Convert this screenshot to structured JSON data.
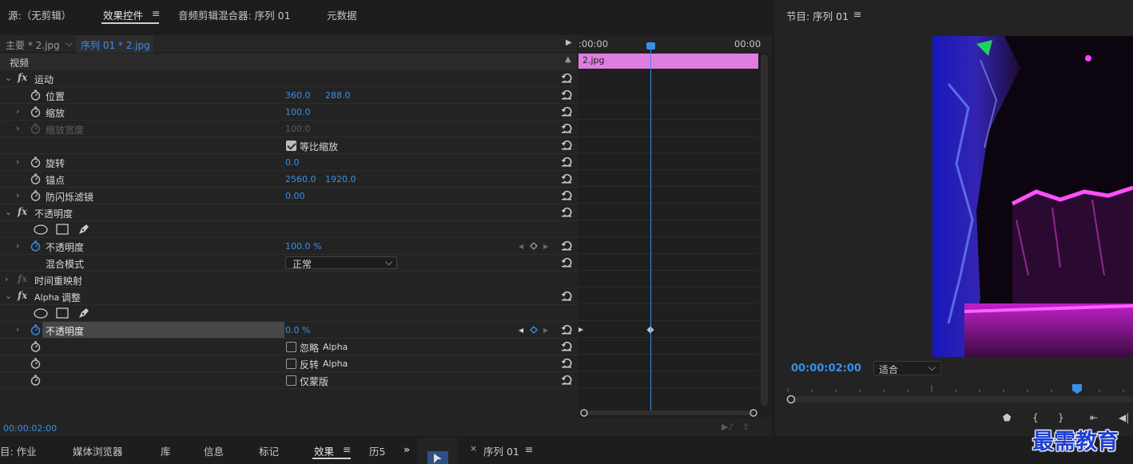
{
  "top_tabs": {
    "source": "源:（无剪辑）",
    "effect_controls": "效果控件",
    "audio_mixer": "音频剪辑混合器: 序列 01",
    "metadata": "元数据"
  },
  "ec": {
    "master_clip": "主要 * 2.jpg",
    "sequence_clip": "序列 01 * 2.jpg",
    "section_video": "视频",
    "timecode_start": ":00:00",
    "timecode_end": "00:00",
    "clip_name": "2.jpg",
    "current_time": "00:00:02:00",
    "motion": {
      "title": "运动",
      "position_label": "位置",
      "position_x": "360.0",
      "position_y": "288.0",
      "scale_label": "缩放",
      "scale_value": "100.0",
      "scale_width_label": "缩放宽度",
      "scale_width_value": "100.0",
      "uniform_scale_label": "等比缩放",
      "rotation_label": "旋转",
      "rotation_value": "0.0",
      "anchor_label": "锚点",
      "anchor_x": "2560.0",
      "anchor_y": "1920.0",
      "antiflicker_label": "防闪烁滤镜",
      "antiflicker_value": "0.00"
    },
    "opacity": {
      "title": "不透明度",
      "opacity_label": "不透明度",
      "opacity_value": "100.0 %",
      "blend_label": "混合模式",
      "blend_value": "正常"
    },
    "time_remap": {
      "title": "时间重映射"
    },
    "alpha_adjust": {
      "title_alpha": "Alpha",
      "title_rest": "调整",
      "opacity_label": "不透明度",
      "opacity_value": "0.0 %",
      "ignore_label": "忽略",
      "invert_label": "反转",
      "alpha_word": "Alpha",
      "mask_only_label": "仅蒙版"
    }
  },
  "program": {
    "title": "节目: 序列 01",
    "timecode": "00:00:02:00",
    "fit": "适合"
  },
  "bottom_tabs": {
    "project": "目: 作业",
    "media_browser": "媒体浏览器",
    "library": "库",
    "info": "信息",
    "markers": "标记",
    "effects": "效果",
    "history": "历5",
    "sequence": "序列 01"
  },
  "watermark": "最需教育",
  "colors": {
    "accent": "#3b8ee8",
    "clip": "#e07ee0",
    "panel": "#232323"
  }
}
